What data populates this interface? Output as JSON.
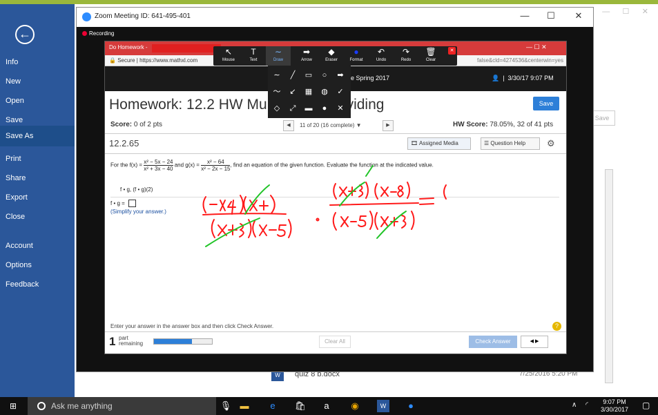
{
  "word": {
    "sidebar": {
      "items": [
        "Info",
        "New",
        "Open",
        "Save",
        "Save As",
        "Print",
        "Share",
        "Export",
        "Close",
        "Account",
        "Options",
        "Feedback"
      ],
      "active": "Save As"
    },
    "bg_save_label": "Save",
    "recent_file": {
      "name": "quiz 8 b.docx",
      "date": "7/25/2016 5:20 PM"
    }
  },
  "zoom": {
    "title": "Zoom Meeting ID: 641-495-401",
    "recording_label": "Recording",
    "controls": [
      "—",
      "☐",
      "✕"
    ],
    "annotate_tools": [
      {
        "icon": "mouse-icon",
        "glyph": "↖",
        "label": "Mouse"
      },
      {
        "icon": "text-icon",
        "glyph": "T",
        "label": "Text"
      },
      {
        "icon": "draw-icon",
        "glyph": "∼",
        "label": "Draw"
      },
      {
        "icon": "arrow-icon",
        "glyph": "➡",
        "label": "Arrow"
      },
      {
        "icon": "eraser-icon",
        "glyph": "◆",
        "label": "Eraser"
      },
      {
        "icon": "format-icon",
        "glyph": "●",
        "label": "Format"
      },
      {
        "icon": "undo-icon",
        "glyph": "↶",
        "label": "Undo"
      },
      {
        "icon": "redo-icon",
        "glyph": "↷",
        "label": "Redo"
      },
      {
        "icon": "clear-icon",
        "glyph": "🗑",
        "label": "Clear"
      }
    ]
  },
  "browser": {
    "tab_title": "Do Homework -",
    "secure_label": "Secure",
    "url": "https://www.mathxl.com",
    "url_tail": "false&cld=4274536&centerwin=yes",
    "controls": "—   ☐   ✕"
  },
  "mathxl": {
    "course": "e Spring 2017",
    "header_date": "3/30/17 9:07 PM",
    "hw_title_left": "Homework: 12.2 HW Mu",
    "hw_title_right": "Dividing",
    "save_label": "Save",
    "score_label": "Score:",
    "score_value": "0 of 2 pts",
    "qnav_text": "11 of 20 (16 complete) ▼",
    "hw_score_label": "HW Score:",
    "hw_score_value": "78.05%, 32 of 41 pts",
    "question_number": "12.2.65",
    "assigned_media": "Assigned Media",
    "question_help": "Question Help",
    "question_text_prefix": "For the f(x) =",
    "f_num": "x² − 5x − 24",
    "f_den": "x² + 3x − 40",
    "and_g": "and g(x) =",
    "g_num": "x² − 64",
    "g_den": "x² − 2x − 15",
    "question_text_suffix": ", find an equation of the given function. Evaluate the function at the indicated value.",
    "sub": "f • g, (f • g)(2)",
    "answer_label": "f • g =",
    "simplify": "(Simplify your answer.)",
    "enter_answer": "Enter your answer in the answer box and then click Check Answer.",
    "help_circle": "?",
    "parts_num": "1",
    "parts_text_1": "part",
    "parts_text_2": "remaining",
    "progress": 0.65,
    "clear_all": "Clear All",
    "check_answer": "Check Answer",
    "ans_nav": "◀   ▶"
  },
  "taskbar": {
    "search_placeholder": "Ask me anything",
    "time": "9:07 PM",
    "date": "3/30/2017"
  },
  "colors": {
    "word_blue": "#2b579a",
    "ink_red": "#ff1a1a",
    "ink_green": "#21c428",
    "browser_red": "#d63b3b",
    "mathxl_blue": "#2d7fd8"
  }
}
